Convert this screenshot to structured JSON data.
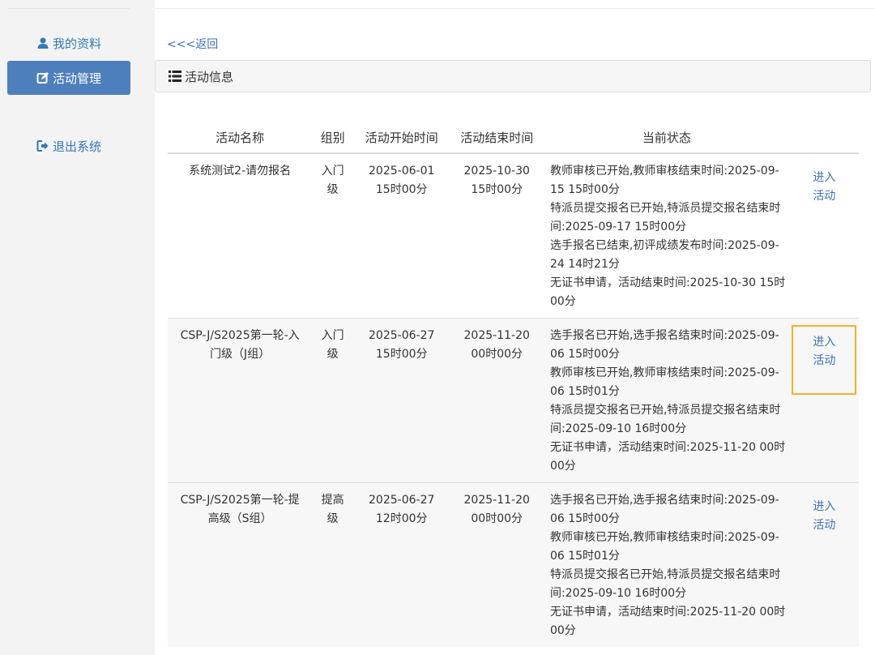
{
  "sidebar": {
    "items": [
      {
        "label": "我的资料",
        "icon": "user-icon"
      },
      {
        "label": "活动管理",
        "icon": "edit-icon",
        "active": true
      },
      {
        "label": "退出系统",
        "icon": "logout-icon"
      }
    ]
  },
  "main": {
    "back_label": "<<<返回",
    "panel_title": "活动信息",
    "panel_icon": "list-icon",
    "table": {
      "headers": [
        "活动名称",
        "组别",
        "活动开始时间",
        "活动结束时间",
        "当前状态",
        ""
      ],
      "rows": [
        {
          "name": "系统测试2-请勿报名",
          "group": "入门级",
          "start": "2025-06-01 15时00分",
          "end": "2025-10-30 15时00分",
          "status": [
            "教师审核已开始,教师审核结束时间:2025-09-15 15时00分",
            "特派员提交报名已开始,特派员提交报名结束时间:2025-09-17 15时00分",
            "选手报名已结束,初评成绩发布时间:2025-09-24 14时21分",
            "无证书申请，活动结束时间:2025-10-30 15时00分"
          ],
          "action": "进入活动"
        },
        {
          "name": "CSP-J/S2025第一轮-入门级（J组）",
          "group": "入门级",
          "start": "2025-06-27 15时00分",
          "end": "2025-11-20 00时00分",
          "status": [
            "选手报名已开始,选手报名结束时间:2025-09-06 15时00分",
            "教师审核已开始,教师审核结束时间:2025-09-06 15时01分",
            "特派员提交报名已开始,特派员提交报名结束时间:2025-09-10 16时00分",
            "无证书申请，活动结束时间:2025-11-20 00时00分"
          ],
          "action": "进入活动"
        },
        {
          "name": "CSP-J/S2025第一轮-提高级（S组）",
          "group": "提高级",
          "start": "2025-06-27 12时00分",
          "end": "2025-11-20 00时00分",
          "status": [
            "选手报名已开始,选手报名结束时间:2025-09-06 15时00分",
            "教师审核已开始,教师审核结束时间:2025-09-06 15时01分",
            "特派员提交报名已开始,特派员提交报名结束时间:2025-09-10 16时00分",
            "无证书申请，活动结束时间:2025-11-20 00时00分"
          ],
          "action": "进入活动"
        }
      ]
    }
  },
  "colors": {
    "accent": "#4d7fbd",
    "link": "#3b73b9",
    "focus_outline": "#f0b428"
  }
}
